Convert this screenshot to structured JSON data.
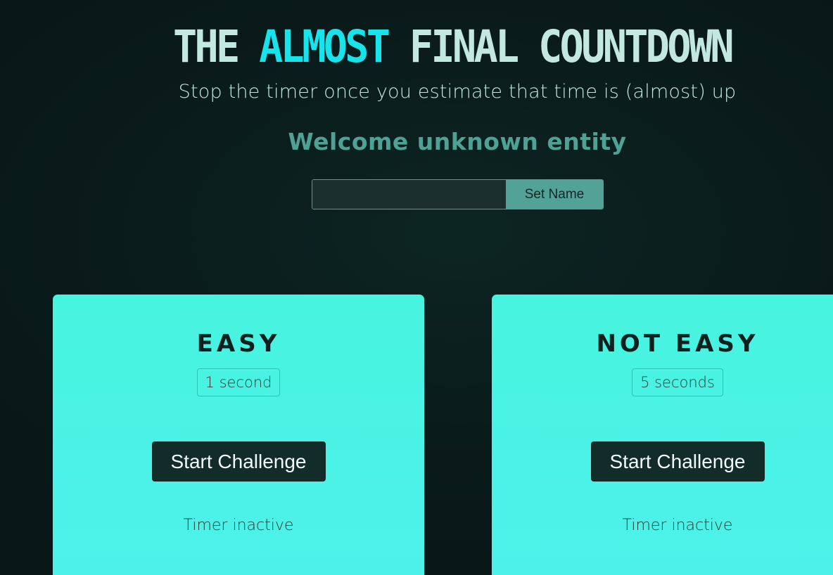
{
  "header": {
    "title_part1": "THE ",
    "title_accent": "ALMOST",
    "title_part2": " FINAL COUNTDOWN",
    "subtitle": "Stop the timer once you estimate that time is (almost) up",
    "welcome": "Welcome unknown entity"
  },
  "name_form": {
    "input_value": "",
    "input_placeholder": "",
    "button_label": "Set Name"
  },
  "challenges": [
    {
      "difficulty": "EASY",
      "duration": "1 second",
      "start_label": "Start Challenge",
      "status": "Timer inactive"
    },
    {
      "difficulty": "NOT EASY",
      "duration": "5 seconds",
      "start_label": "Start Challenge",
      "status": "Timer inactive"
    }
  ],
  "colors": {
    "background": "#0a1b1b",
    "title": "#c3e8df",
    "accent": "#16e3ea",
    "welcome": "#4fa194",
    "card": "#47f4df",
    "button_dark": "#112c29"
  }
}
